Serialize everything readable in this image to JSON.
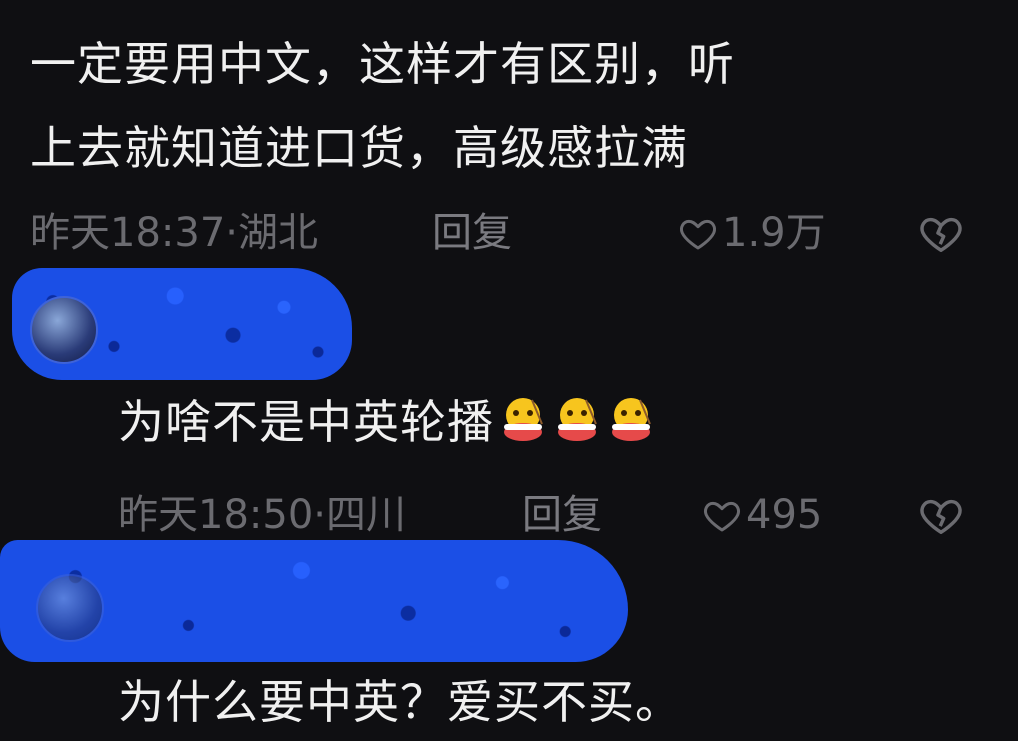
{
  "comments": [
    {
      "text_line1": "一定要用中文，这样才有区别，听",
      "text_line2": "上去就知道进口货，高级感拉满",
      "time_location": "昨天18:37·湖北",
      "reply_label": "回复",
      "like_count": "1.9万"
    },
    {
      "text": "为啥不是中英轮播",
      "emoji_icon": "eating-bowl-emoji",
      "emoji_count": 3,
      "time_location": "昨天18:50·四川",
      "reply_label": "回复",
      "like_count": "495"
    },
    {
      "text": "为什么要中英？爱买不买。"
    }
  ],
  "colors": {
    "background": "#0f0f12",
    "text": "#f0f0f0",
    "meta": "#6b6b70",
    "redaction": "#1b4fe6"
  }
}
